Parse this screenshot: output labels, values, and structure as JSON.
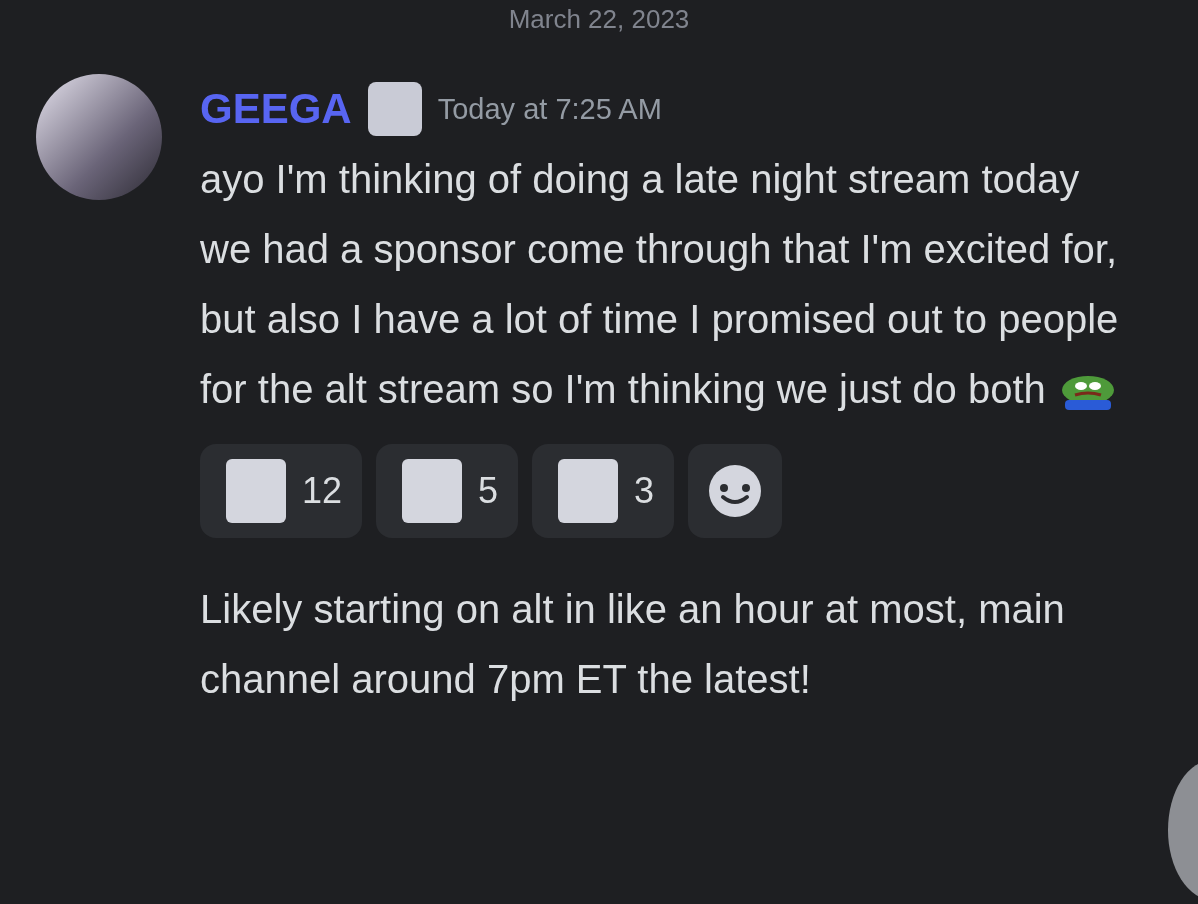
{
  "date_divider": "March 22, 2023",
  "messages": [
    {
      "author": "GEEGA",
      "timestamp": "Today at 7:25 AM",
      "lines": [
        "ayo I'm thinking of doing a late night stream today",
        "we had a sponsor come through that I'm excited for, but also I have a lot of time I promised out to people for the alt stream so I'm thinking we just do both"
      ],
      "reactions": [
        {
          "count": "12"
        },
        {
          "count": "5"
        },
        {
          "count": "3"
        }
      ]
    },
    {
      "lines": [
        "Likely starting on alt in like an hour at most, main channel around 7pm ET the latest!"
      ]
    }
  ]
}
